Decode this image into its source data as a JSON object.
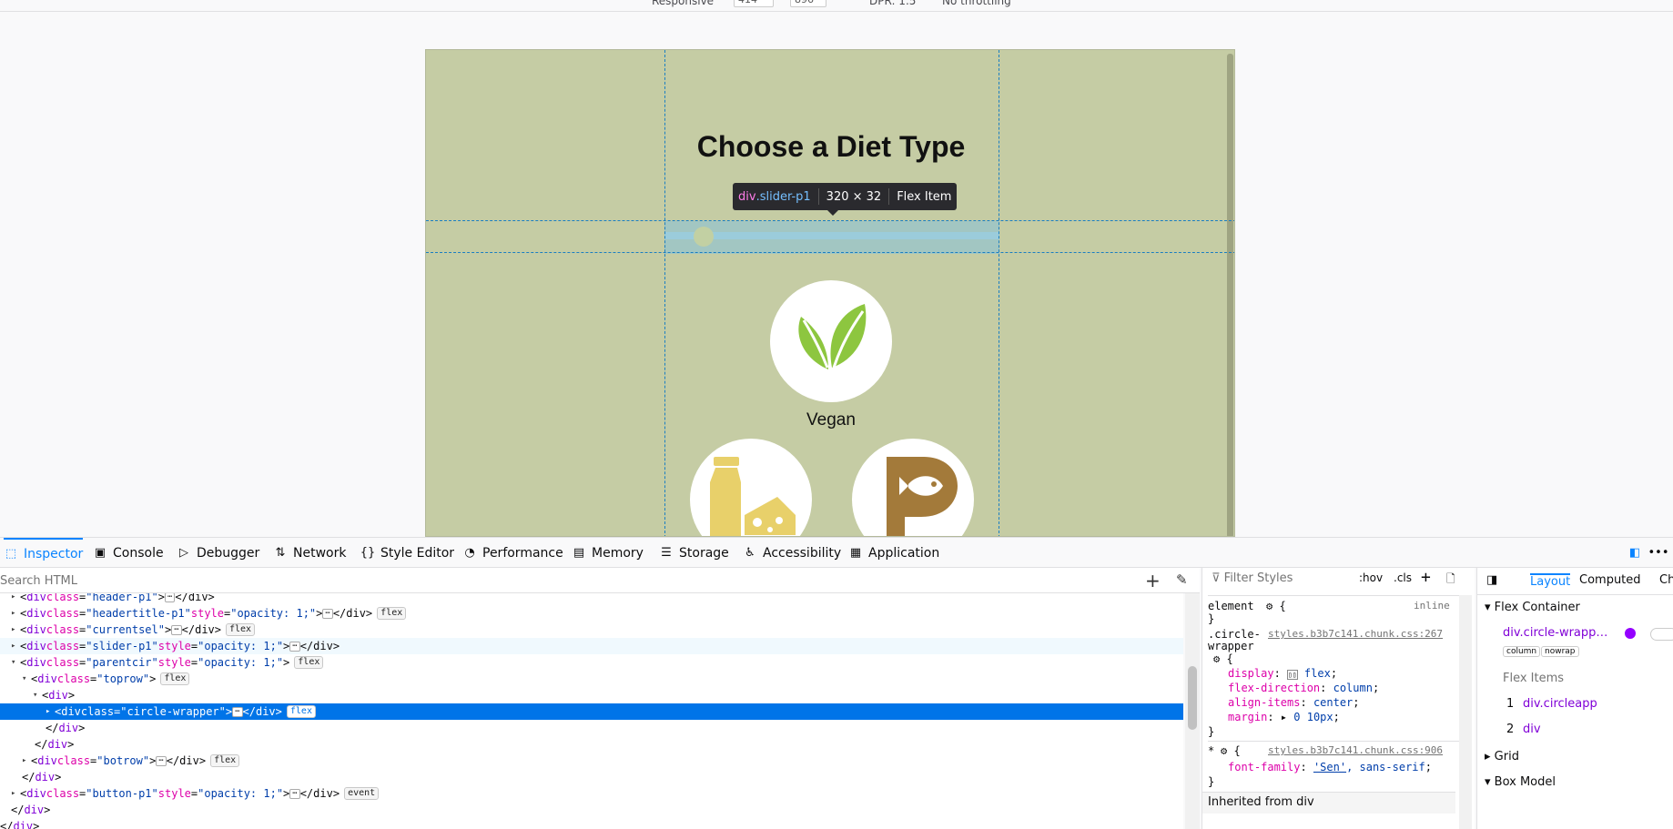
{
  "device_toolbar": {
    "responsive": "Responsive",
    "width": "414",
    "height": "896",
    "dpr": "DPR: 1.5",
    "throttle": "No throttling"
  },
  "page": {
    "title": "Choose a Diet Type",
    "vegan_label": "Vegan"
  },
  "tooltip": {
    "tag": "div",
    "cls": ".slider-p1",
    "size": "320 × 32",
    "type": "Flex Item"
  },
  "tabs": [
    "Inspector",
    "Console",
    "Debugger",
    "Network",
    "Style Editor",
    "Performance",
    "Memory",
    "Storage",
    "Accessibility",
    "Application"
  ],
  "search": {
    "placeholder": "Search HTML"
  },
  "badges": {
    "flex": "flex",
    "event": "event"
  },
  "markup": {
    "l0": {
      "tag": "div",
      "an": "class",
      "av": "\"header-p1\""
    },
    "l1": {
      "an": "class",
      "av": "\"headertitle-p1\"",
      "an2": "style",
      "av2": "\"opacity: 1;\""
    },
    "l2": {
      "an": "class",
      "av": "\"currentsel\""
    },
    "l3": {
      "an": "class",
      "av": "\"slider-p1\"",
      "an2": "style",
      "av2": "\"opacity: 1;\""
    },
    "l4": {
      "an": "class",
      "av": "\"parentcir\"",
      "an2": "style",
      "av2": "\"opacity: 1;\""
    },
    "l5": {
      "an": "class",
      "av": "\"toprow\""
    },
    "l7": {
      "an": "class",
      "av": "\"circle-wrapper\""
    },
    "l11": {
      "an": "class",
      "av": "\"botrow\""
    },
    "l13": {
      "an": "class",
      "av": "\"button-p1\"",
      "an2": "style",
      "av2": "\"opacity: 1;\""
    }
  },
  "rules": {
    "filter_placeholder": "Filter Styles",
    "hov": ":hov",
    "cls": ".cls",
    "element": "element",
    "inline": "inline",
    "sel1": ".circle-",
    "sel1b": "wrapper",
    "src1": "styles.b3b7c141.chunk.css:267",
    "p1": "display",
    "v1": "flex",
    "p2": "flex-direction",
    "v2": "column",
    "p3": "align-items",
    "v3": "center",
    "p4": "margin",
    "v4": "0 10px",
    "sel2": "*",
    "src2": "styles.b3b7c141.chunk.css:906",
    "p5": "font-family",
    "v5a": "'Sen'",
    "v5b": ", sans-serif",
    "inherited": "Inherited from div"
  },
  "layout_panel": {
    "tabs": [
      "Layout",
      "Computed",
      "Ch"
    ],
    "flex_container": "Flex Container",
    "container_name": "div.circle-wrapp…",
    "chip1": "column",
    "chip2": "nowrap",
    "flex_items": "Flex Items",
    "item1_no": "1",
    "item1": "div.circleapp",
    "item2_no": "2",
    "item2": "div",
    "grid": "Grid",
    "box_model": "Box Model"
  },
  "colors": {
    "page_bg": "#c5cca4",
    "accent": "#0a84ff",
    "selection": "#0074e8",
    "leaf_green": "#8dc63f",
    "milk_yellow": "#e8d06a",
    "fish_brown": "#a37a3a"
  }
}
